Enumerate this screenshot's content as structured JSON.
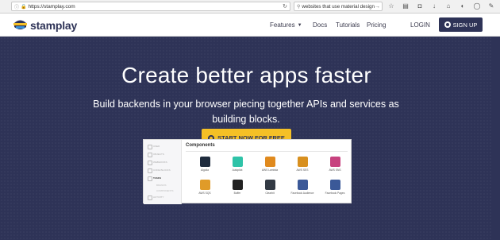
{
  "browser": {
    "url": "https://stamplay.com",
    "search_text": "websites that use material design"
  },
  "header": {
    "brand": "stamplay",
    "nav": {
      "features": "Features",
      "docs": "Docs",
      "tutorials": "Tutorials",
      "pricing": "Pricing",
      "login": "LOGIN"
    },
    "signup_label": "SIGN UP"
  },
  "hero": {
    "title": "Create better apps faster",
    "subtitle": "Build backends in your browser piecing together APIs and services as building blocks.",
    "cta_label": "START NOW FOR FREE"
  },
  "preview": {
    "sidebar": [
      "USER",
      "OBJECTS",
      "WEBHOOKS",
      "CODE BLOCKS",
      "TASKS",
      "ACTIVITY"
    ],
    "sidebar_sub": [
      "BRANDS",
      "COMPONENTS"
    ],
    "section_title": "Components",
    "components": [
      {
        "label": "Algolia",
        "color": "#1e2b3d"
      },
      {
        "label": "Autopilot",
        "color": "#2fc3a8"
      },
      {
        "label": "AWS Lambda",
        "color": "#e08a1e"
      },
      {
        "label": "AWS SES",
        "color": "#d8901f"
      },
      {
        "label": "AWS SNS",
        "color": "#c7427f"
      },
      {
        "label": "AWS SQS",
        "color": "#e09b28"
      },
      {
        "label": "Buffer",
        "color": "#222222"
      },
      {
        "label": "Clearbit",
        "color": "#333a44"
      },
      {
        "label": "Facebook Audience",
        "color": "#3b5998"
      },
      {
        "label": "Facebook Pages",
        "color": "#3b5998"
      }
    ]
  },
  "colors": {
    "navy": "#2e3357",
    "yellow": "#f5c026"
  }
}
